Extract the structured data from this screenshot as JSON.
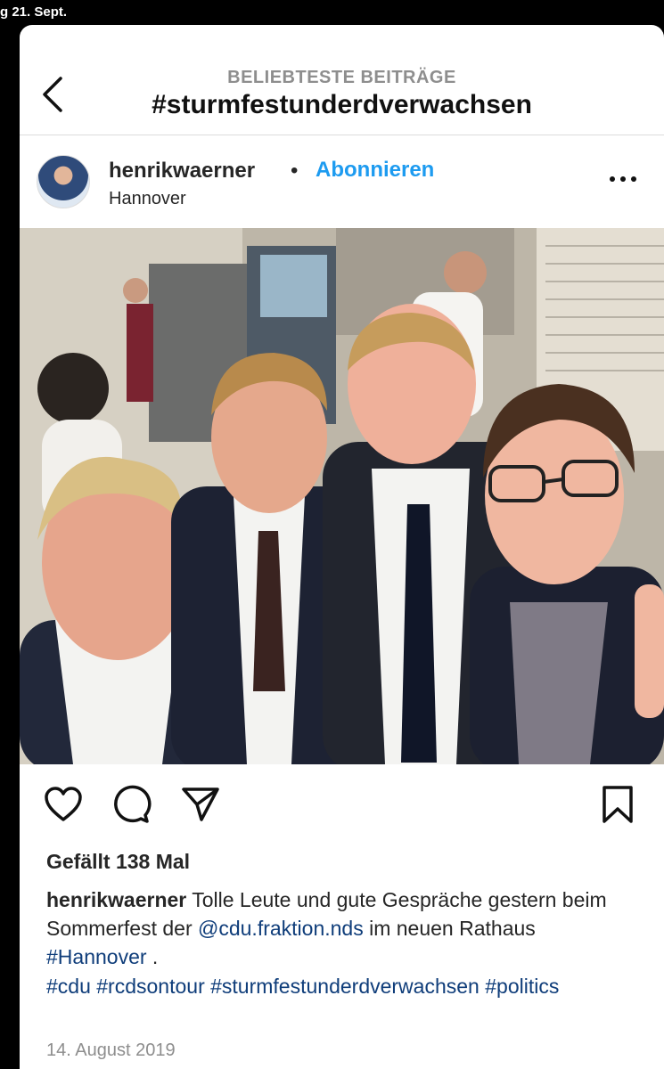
{
  "status_bar": {
    "text": "g 21. Sept."
  },
  "header": {
    "subtitle": "BELIEBTESTE BEITRÄGE",
    "title": "#sturmfestunderdverwachsen",
    "back_icon": "chevron-left-icon"
  },
  "post": {
    "username": "henrikwaerner",
    "separator": "•",
    "follow_label": "Abonnieren",
    "location": "Hannover",
    "more_icon": "more-horizontal-icon",
    "image": "group-selfie-photo",
    "actions": [
      "heart-icon",
      "comment-icon",
      "share-icon",
      "bookmark-icon"
    ],
    "likes": "Gefällt 138 Mal",
    "caption": {
      "username": "henrikwaerner",
      "text_1": " Tolle Leute und gute Gespräche gestern beim Sommerfest der ",
      "mention": "@cdu.fraktion.nds",
      "text_2": " im neuen Rathaus ",
      "hashtag_inline": "#Hannover",
      "text_3": " ."
    },
    "hashtags": [
      "#cdu",
      "#rcdsontour",
      "#sturmfestunderdverwachsen",
      "#politics"
    ],
    "date": "14. August 2019"
  },
  "colors": {
    "link_blue": "#1d9bf0",
    "hashtag_blue": "#0f3d7a",
    "muted_gray": "#8e8e8e"
  }
}
